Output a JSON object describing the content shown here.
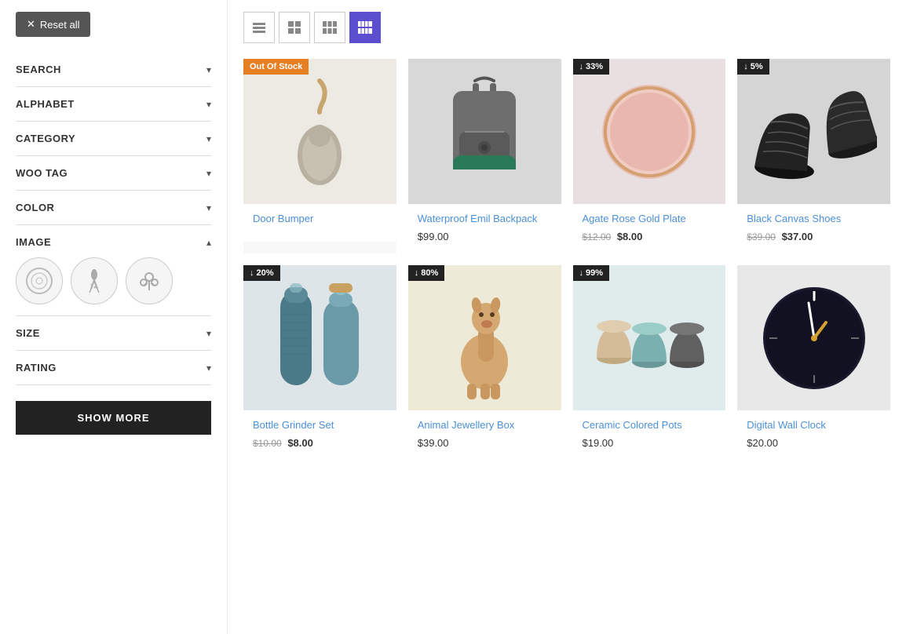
{
  "sidebar": {
    "reset_label": "Reset all",
    "filters": [
      {
        "id": "search",
        "label": "SEARCH",
        "expanded": false
      },
      {
        "id": "alphabet",
        "label": "ALPHABET",
        "expanded": false
      },
      {
        "id": "category",
        "label": "CATEGORY",
        "expanded": false
      },
      {
        "id": "woo-tag",
        "label": "WOO TAG",
        "expanded": false
      },
      {
        "id": "color",
        "label": "COLOR",
        "expanded": false
      },
      {
        "id": "image",
        "label": "IMAGE",
        "expanded": true
      },
      {
        "id": "size",
        "label": "SIZE",
        "expanded": false
      },
      {
        "id": "rating",
        "label": "RATING",
        "expanded": false
      }
    ],
    "show_more_label": "SHOW MORE"
  },
  "toolbar": {
    "views": [
      {
        "id": "list",
        "label": "List view",
        "active": false
      },
      {
        "id": "grid2",
        "label": "2-column grid",
        "active": false
      },
      {
        "id": "grid3",
        "label": "3-column grid",
        "active": false
      },
      {
        "id": "grid4",
        "label": "4-column grid",
        "active": true
      }
    ]
  },
  "products": [
    {
      "id": 1,
      "name": "Door Bumper",
      "price_display": "",
      "badge": "Out Of Stock",
      "badge_type": "out",
      "color": "#e5e0d8",
      "row": 1
    },
    {
      "id": 2,
      "name": "Waterproof Emil Backpack",
      "price": "$99.00",
      "badge": "",
      "badge_type": "",
      "color": "#d0d0d0",
      "row": 1
    },
    {
      "id": 3,
      "name": "Agate Rose Gold Plate",
      "price_old": "$12.00",
      "price_new": "$8.00",
      "badge": "↓ 33%",
      "badge_type": "discount",
      "color": "#e8e0e0",
      "row": 1
    },
    {
      "id": 4,
      "name": "Black Canvas Shoes",
      "price_old": "$39.00",
      "price_new": "$37.00",
      "badge": "↓ 5%",
      "badge_type": "discount",
      "color": "#d8d8d8",
      "row": 1
    },
    {
      "id": 5,
      "name": "Bottle Grinder Set",
      "price_old": "$10.00",
      "price_new": "$8.00",
      "badge": "↓ 20%",
      "badge_type": "discount",
      "color": "#dde5e8",
      "row": 2
    },
    {
      "id": 6,
      "name": "Animal Jewellery Box",
      "price": "$39.00",
      "badge": "↓ 80%",
      "badge_type": "discount",
      "color": "#e8e8e0",
      "row": 2
    },
    {
      "id": 7,
      "name": "Ceramic Colored Pots",
      "price": "$19.00",
      "badge": "↓ 99%",
      "badge_type": "discount",
      "color": "#e0e8e8",
      "row": 2
    },
    {
      "id": 8,
      "name": "Digital Wall Clock",
      "price": "$20.00",
      "badge": "",
      "badge_type": "",
      "color": "#e0e0e0",
      "row": 2
    }
  ]
}
